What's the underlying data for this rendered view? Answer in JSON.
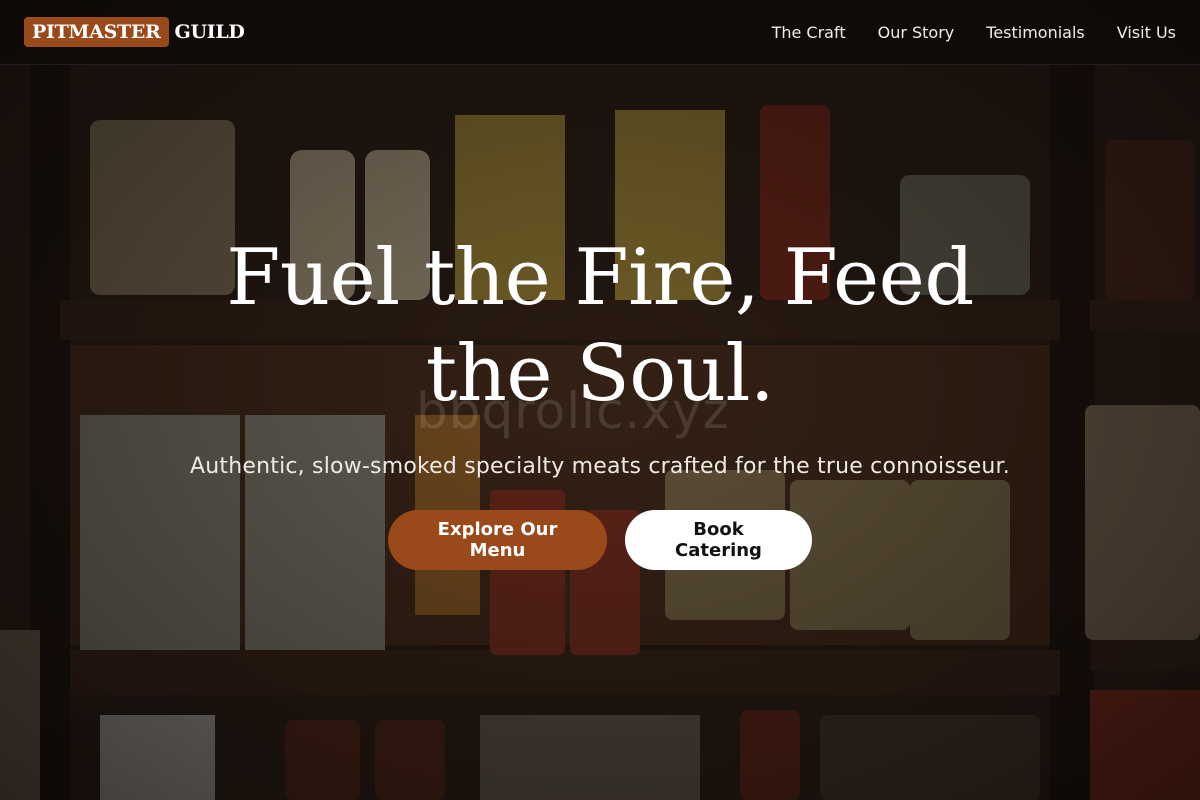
{
  "brand": {
    "mark": "PITMASTER",
    "rest": "GUILD",
    "accent_color": "#9a4a1a"
  },
  "nav": {
    "items": [
      {
        "label": "The Craft"
      },
      {
        "label": "Our Story"
      },
      {
        "label": "Testimonials"
      },
      {
        "label": "Visit Us"
      }
    ]
  },
  "hero": {
    "headline": "Fuel the Fire, Feed the Soul.",
    "subheadline": "Authentic, slow-smoked specialty meats crafted for the true connoisseur.",
    "watermark": "bbqrolic.xyz",
    "primary_cta": "Explore Our Menu",
    "secondary_cta": "Book Catering"
  }
}
